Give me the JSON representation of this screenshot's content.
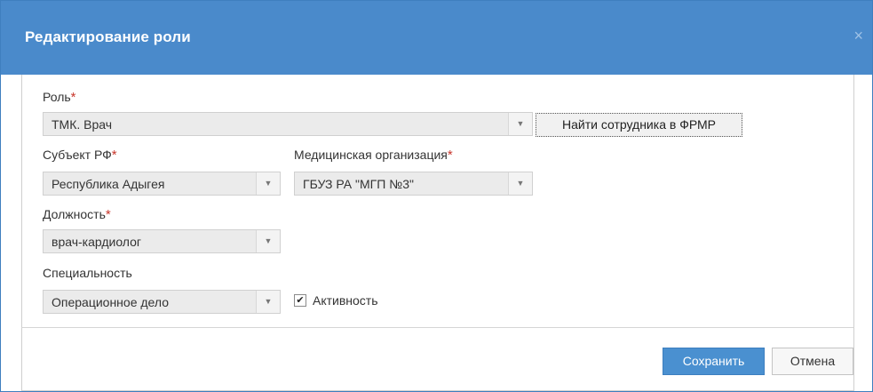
{
  "dialog": {
    "title": "Редактирование роли",
    "close_glyph": "×"
  },
  "form": {
    "role": {
      "label": "Роль",
      "required": "*",
      "value": "ТМК. Врач",
      "arrow_glyph": "▼"
    },
    "find_button": "Найти сотрудника в ФРМР",
    "subject": {
      "label": "Субъект РФ",
      "required": "*",
      "value": "Республика Адыгея",
      "arrow_glyph": "▼"
    },
    "organization": {
      "label": "Медицинская организация",
      "required": "*",
      "value": "ГБУЗ РА \"МГП №3\"",
      "arrow_glyph": "▼"
    },
    "position": {
      "label": "Должность",
      "required": "*",
      "value": "врач-кардиолог",
      "arrow_glyph": "▼"
    },
    "specialty": {
      "label": "Специальность",
      "value": "Операционное дело",
      "arrow_glyph": "▼"
    },
    "active": {
      "label": "Активность",
      "checked": true,
      "check_glyph": "✔"
    }
  },
  "footer": {
    "save_label": "Сохранить",
    "cancel_label": "Отмена"
  },
  "colors": {
    "header_bg": "#4a8acb",
    "primary_button": "#4a90d0",
    "required_marker": "#c8362b"
  }
}
